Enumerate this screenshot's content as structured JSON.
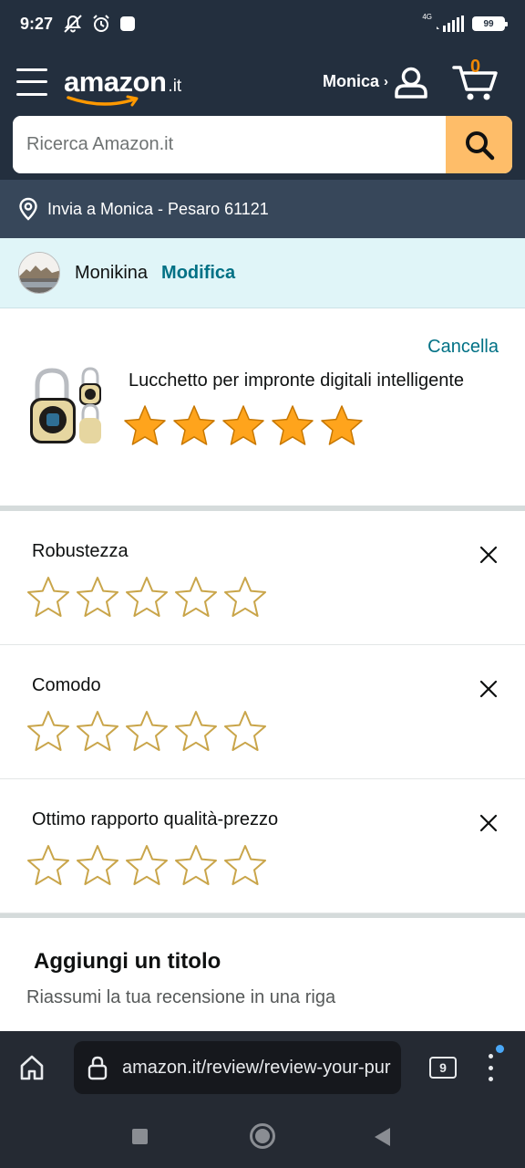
{
  "status_bar": {
    "time": "9:27",
    "network": "4G",
    "battery": "99"
  },
  "header": {
    "logo": "amazon",
    "logo_tld": ".it",
    "account_label": "Monica",
    "account_chevron": "›",
    "cart_count": "0"
  },
  "search": {
    "placeholder": "Ricerca Amazon.it"
  },
  "delivery": {
    "text": "Invia a Monica - Pesaro 61121"
  },
  "profile": {
    "name": "Monikina",
    "edit_label": "Modifica"
  },
  "product": {
    "cancel_label": "Cancella",
    "title": "Lucchetto per impronte digitali intelligente",
    "rating": 5,
    "max_rating": 5
  },
  "attributes": [
    {
      "label": "Robustezza",
      "rating": 0
    },
    {
      "label": "Comodo",
      "rating": 0
    },
    {
      "label": "Ottimo rapporto qualità-prezzo",
      "rating": 0
    }
  ],
  "title_section": {
    "heading": "Aggiungi un titolo",
    "placeholder": "Riassumi la tua recensione in una riga"
  },
  "browser": {
    "url": "amazon.it/review/review-your-purchases",
    "tab_count": "9"
  },
  "colors": {
    "header_bg": "#232f3e",
    "delivery_bg": "#37475a",
    "search_button": "#febd69",
    "link": "#007185",
    "star_fill": "#ffa41c",
    "star_outline": "#c9a54a",
    "profile_bg": "#e0f5f8"
  },
  "icons": {
    "menu": "hamburger-icon",
    "account": "user-icon",
    "cart": "cart-icon",
    "search": "search-icon",
    "location": "location-pin-icon",
    "close": "close-icon",
    "home": "home-icon",
    "lock": "lock-icon"
  }
}
